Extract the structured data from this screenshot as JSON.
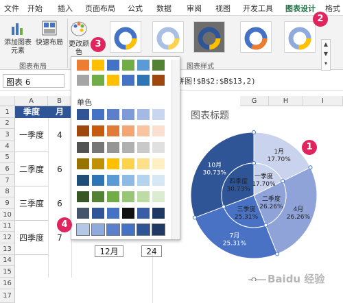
{
  "tabs": [
    "文件",
    "开始",
    "插入",
    "页面布局",
    "公式",
    "数据",
    "审阅",
    "视图",
    "开发工具",
    "图表设计",
    "格式"
  ],
  "active_tab": "图表设计",
  "ribbon": {
    "add_element": "添加图表元素",
    "quick_layout": "快速布局",
    "change_colors": "更改颜色",
    "group_layout": "图表布局",
    "group_styles": "图表样式"
  },
  "name_box": "图表 6",
  "formula": "饼图!$B$2:$B$13,2)",
  "columns": [
    "A",
    "B",
    "G",
    "H",
    "I"
  ],
  "rows": [
    "1",
    "2",
    "3",
    "4",
    "5",
    "6",
    "7",
    "8",
    "9",
    "10",
    "11",
    "12",
    "13",
    "14",
    "15",
    "16",
    "17"
  ],
  "table": {
    "header_a": "季度",
    "header_b": "月",
    "quarters": [
      "一季度",
      "二季度",
      "三季度",
      "四季度"
    ],
    "b_values": [
      "4",
      "6",
      "6",
      "7"
    ],
    "footer": [
      "12月",
      "24"
    ]
  },
  "palette": {
    "mono_label": "单色",
    "colorful_rows": [
      [
        "#ed7d31",
        "#ffc000",
        "#4472c4",
        "#70ad47",
        "#5b9bd5",
        "#548235"
      ],
      [
        "#a5a5a5",
        "#70ad47",
        "#ffc000",
        "#4472c4",
        "#2e75b6",
        "#9e480e"
      ]
    ],
    "mono_rows": [
      [
        "#2f5597",
        "#4472c4",
        "#5b7fcc",
        "#7d9bd8",
        "#a4b9e4",
        "#c9d6ef"
      ],
      [
        "#9e480e",
        "#c55a11",
        "#e07b39",
        "#f4a574",
        "#f8c4a2",
        "#fbe0cf"
      ],
      [
        "#525252",
        "#767676",
        "#959595",
        "#b0b0b0",
        "#c9c9c9",
        "#e0e0e0"
      ],
      [
        "#997300",
        "#bf9000",
        "#ffc000",
        "#ffd24d",
        "#ffe08a",
        "#ffefc2"
      ],
      [
        "#1f4e79",
        "#2e75b6",
        "#5b9bd5",
        "#8dbbe5",
        "#b4d3ee",
        "#d6e7f6"
      ],
      [
        "#375623",
        "#548235",
        "#70ad47",
        "#97c677",
        "#bcdca6",
        "#dcecd0"
      ],
      [
        "#44546a",
        "#2f5597",
        "#4472c4",
        "#111111",
        "#3a5da8",
        "#1f3864"
      ],
      [
        "#b4c7e7",
        "#8faadc",
        "#5b7fcc",
        "#4472c4",
        "#2f5597",
        "#1f3864"
      ]
    ]
  },
  "chart": {
    "title": "图表标题"
  },
  "chart_data": {
    "type": "pie",
    "title": "图表标题",
    "series": [
      {
        "name": "月",
        "categories": [
          "1月",
          "4月",
          "7月",
          "10月"
        ],
        "values": [
          17.7,
          26.26,
          25.31,
          30.73
        ],
        "colors": [
          "#c9d3ee",
          "#8fa3d9",
          "#4a72c4",
          "#2f5597"
        ]
      },
      {
        "name": "季度",
        "categories": [
          "一季度",
          "二季度",
          "三季度",
          "四季度"
        ],
        "values": [
          17.7,
          26.26,
          25.31,
          30.73
        ],
        "colors": [
          "#c9d3ee",
          "#8fa3d9",
          "#4a72c4",
          "#2f5597"
        ]
      }
    ],
    "data_labels": {
      "outer": [
        "1月\n17.70%",
        "4月\n26.26%",
        "7月\n25.31%",
        "10月\n30.73%"
      ],
      "inner": [
        "一季度\n17.70%",
        "二季度\n26.26%",
        "三季度\n25.31%",
        "四季度\n30.73%"
      ]
    }
  },
  "markers": [
    "1",
    "2",
    "3",
    "4"
  ],
  "watermark": "Baidu 经验"
}
